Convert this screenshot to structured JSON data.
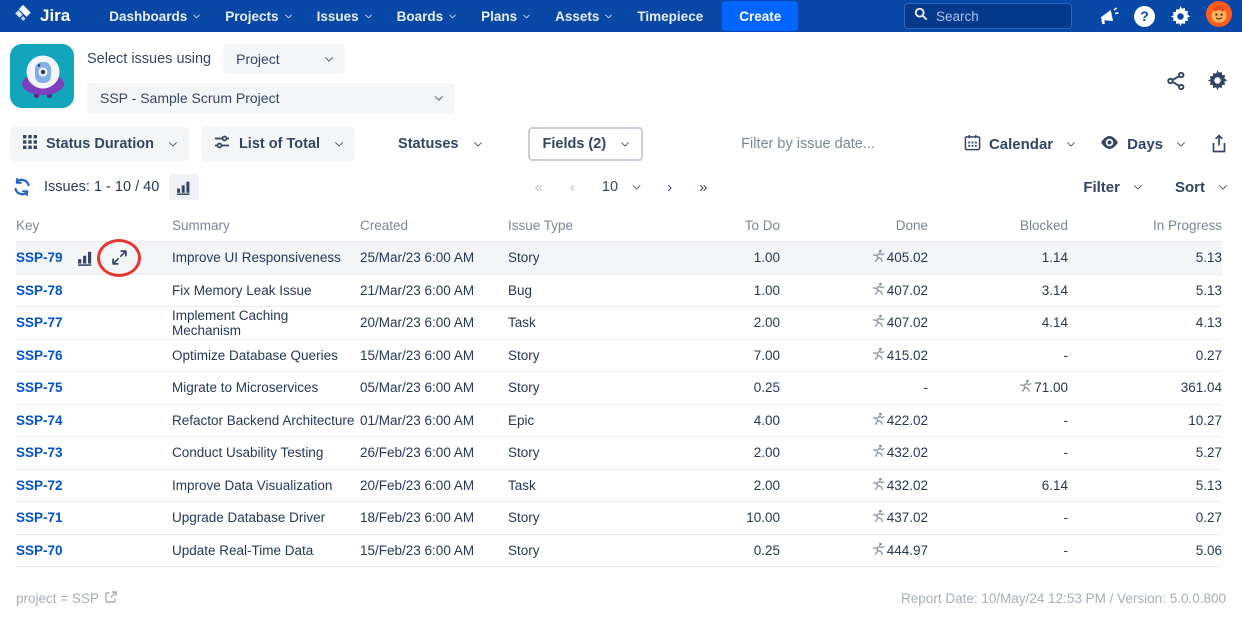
{
  "nav": {
    "logo_text": "Jira",
    "items": [
      {
        "label": "Dashboards",
        "chevron": true
      },
      {
        "label": "Projects",
        "chevron": true
      },
      {
        "label": "Issues",
        "chevron": true
      },
      {
        "label": "Boards",
        "chevron": true
      },
      {
        "label": "Plans",
        "chevron": true
      },
      {
        "label": "Assets",
        "chevron": true
      },
      {
        "label": "Timepiece",
        "chevron": false
      }
    ],
    "create_label": "Create",
    "search_placeholder": "Search"
  },
  "header": {
    "select_label": "Select issues using",
    "mode_dropdown_value": "Project",
    "project_dropdown_value": "SSP - Sample Scrum Project"
  },
  "toolbar": {
    "view_dropdown": "Status Duration",
    "list_dropdown": "List of Total",
    "statuses_dropdown": "Statuses",
    "fields_dropdown": "Fields (2)",
    "date_filter_placeholder": "Filter by issue date...",
    "calendar_dropdown": "Calendar",
    "unit_dropdown": "Days"
  },
  "issuesbar": {
    "count_label": "Issues: 1 - 10 / 40",
    "page_size_value": "10",
    "first_glyph": "«",
    "prev_glyph": "‹",
    "next_glyph": "›",
    "last_glyph": "»",
    "filter_dropdown": "Filter",
    "sort_dropdown": "Sort"
  },
  "table": {
    "columns": [
      "Key",
      "Summary",
      "Created",
      "Issue Type",
      "To Do",
      "Done",
      "Blocked",
      "In Progress"
    ],
    "rows": [
      {
        "key": "SSP-79",
        "summary": "Improve UI Responsiveness",
        "created": "25/Mar/23 6:00 AM",
        "type": "Story",
        "todo": "1.00",
        "done": "405.02",
        "done_icon": true,
        "blocked": "1.14",
        "blocked_icon": false,
        "in_progress": "5.13",
        "hovered": true
      },
      {
        "key": "SSP-78",
        "summary": "Fix Memory Leak Issue",
        "created": "21/Mar/23 6:00 AM",
        "type": "Bug",
        "todo": "1.00",
        "done": "407.02",
        "done_icon": true,
        "blocked": "3.14",
        "blocked_icon": false,
        "in_progress": "5.13",
        "hovered": false
      },
      {
        "key": "SSP-77",
        "summary": "Implement Caching Mechanism",
        "created": "20/Mar/23 6:00 AM",
        "type": "Task",
        "todo": "2.00",
        "done": "407.02",
        "done_icon": true,
        "blocked": "4.14",
        "blocked_icon": false,
        "in_progress": "4.13",
        "hovered": false
      },
      {
        "key": "SSP-76",
        "summary": "Optimize Database Queries",
        "created": "15/Mar/23 6:00 AM",
        "type": "Story",
        "todo": "7.00",
        "done": "415.02",
        "done_icon": true,
        "blocked": "-",
        "blocked_icon": false,
        "in_progress": "0.27",
        "hovered": false
      },
      {
        "key": "SSP-75",
        "summary": "Migrate to Microservices",
        "created": "05/Mar/23 6:00 AM",
        "type": "Story",
        "todo": "0.25",
        "done": "-",
        "done_icon": false,
        "blocked": "71.00",
        "blocked_icon": true,
        "in_progress": "361.04",
        "hovered": false
      },
      {
        "key": "SSP-74",
        "summary": "Refactor Backend Architecture",
        "created": "01/Mar/23 6:00 AM",
        "type": "Epic",
        "todo": "4.00",
        "done": "422.02",
        "done_icon": true,
        "blocked": "-",
        "blocked_icon": false,
        "in_progress": "10.27",
        "hovered": false
      },
      {
        "key": "SSP-73",
        "summary": "Conduct Usability Testing",
        "created": "26/Feb/23 6:00 AM",
        "type": "Story",
        "todo": "2.00",
        "done": "432.02",
        "done_icon": true,
        "blocked": "-",
        "blocked_icon": false,
        "in_progress": "5.27",
        "hovered": false
      },
      {
        "key": "SSP-72",
        "summary": "Improve Data Visualization",
        "created": "20/Feb/23 6:00 AM",
        "type": "Task",
        "todo": "2.00",
        "done": "432.02",
        "done_icon": true,
        "blocked": "6.14",
        "blocked_icon": false,
        "in_progress": "5.13",
        "hovered": false
      },
      {
        "key": "SSP-71",
        "summary": "Upgrade Database Driver",
        "created": "18/Feb/23 6:00 AM",
        "type": "Story",
        "todo": "10.00",
        "done": "437.02",
        "done_icon": true,
        "blocked": "-",
        "blocked_icon": false,
        "in_progress": "0.27",
        "hovered": false
      },
      {
        "key": "SSP-70",
        "summary": "Update Real-Time Data",
        "created": "15/Feb/23 6:00 AM",
        "type": "Story",
        "todo": "0.25",
        "done": "444.97",
        "done_icon": true,
        "blocked": "-",
        "blocked_icon": false,
        "in_progress": "5.06",
        "hovered": false
      }
    ]
  },
  "footer": {
    "query_label": "project = SSP",
    "report_label": "Report Date: 10/May/24 12:53 PM / Version: 5.0.0.800"
  },
  "colors": {
    "nav_bg": "#0747A6",
    "create_bg": "#0065FF",
    "link_blue": "#0052CC",
    "icon_navy": "#344563",
    "row_hover_bg": "#F4F5F7",
    "table_border": "#E9EBEE",
    "muted_text": "#7A869A",
    "body_text": "#253858",
    "annotation_red": "#E5352C",
    "runner_gray": "#8993A4",
    "app_icon_teal": "#12A5BC",
    "app_icon_purple": "#7C3FBE"
  }
}
